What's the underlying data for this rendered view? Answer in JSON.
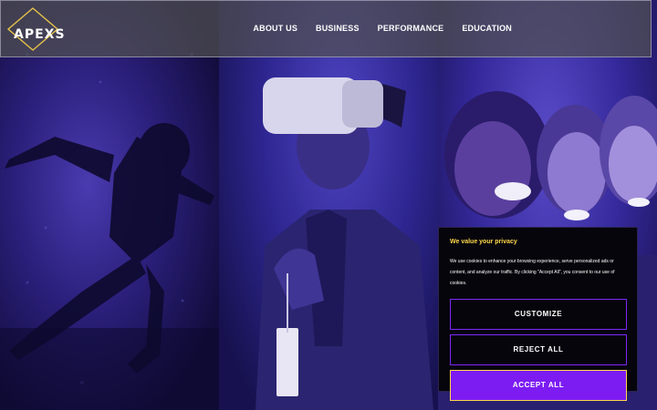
{
  "brand": {
    "name": "APEXS"
  },
  "nav": {
    "links": [
      "ABOUT US",
      "BUSINESS",
      "PERFORMANCE",
      "EDUCATION"
    ]
  },
  "hero": {
    "panels": [
      "athlete-sprinting-image",
      "vr-headset-man-image",
      "smiling-women-image"
    ]
  },
  "cookie_banner": {
    "title": "We value your privacy",
    "body": "We use cookies to enhance your browsing experience, serve personalized ads or content, and analyze our traffic. By clicking \"Accept All\", you consent to our use of cookies.",
    "customize_label": "CUSTOMIZE",
    "reject_label": "REJECT ALL",
    "accept_label": "ACCEPT ALL"
  },
  "colors": {
    "accent_purple": "#7c1cf2",
    "accent_yellow": "#ffd84a",
    "overlay_blue": "#2e2690"
  }
}
